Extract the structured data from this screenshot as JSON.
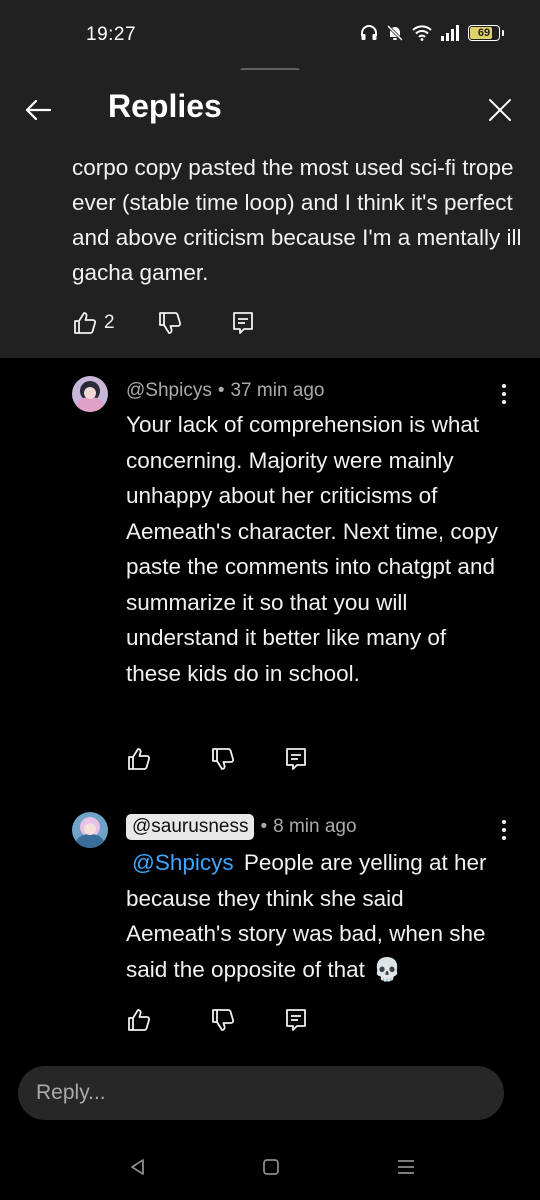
{
  "status_bar": {
    "time": "19:27",
    "battery": "69",
    "icons": [
      "headphones-icon",
      "mute-bell-icon",
      "wifi-icon",
      "signal-icon",
      "battery-icon"
    ]
  },
  "header": {
    "title": "Replies",
    "back_icon": "arrow-left-icon",
    "close_icon": "close-icon"
  },
  "parent_comment": {
    "text": "corpo copy pasted the most used sci-fi trope ever (stable time loop) and I think it's perfect and above criticism because I'm a mentally ill gacha gamer.",
    "like_count": "2"
  },
  "replies": [
    {
      "author": "@Shpicys",
      "separator": "•",
      "time": "37 min ago",
      "text": "Your lack of comprehension is what concerning. Majority were mainly unhappy about her criticisms of Aemeath's character. Next time, copy paste the comments into chatgpt and summarize it so that you will understand it better like many of these kids do in school."
    },
    {
      "author": "@saurusness",
      "separator": "•",
      "time": "8 min ago",
      "mention": "@Shpicys",
      "text": "People are yelling at her because they think she said Aemeath's story was bad, when she said the opposite of that",
      "emoji": "💀"
    }
  ],
  "reply_bar": {
    "placeholder": "Reply..."
  },
  "colors": {
    "background": "#000000",
    "panel": "#212121",
    "mention": "#3ea6ff",
    "secondary_text": "#aaaaaa",
    "battery_fill": "#e0d26a"
  }
}
